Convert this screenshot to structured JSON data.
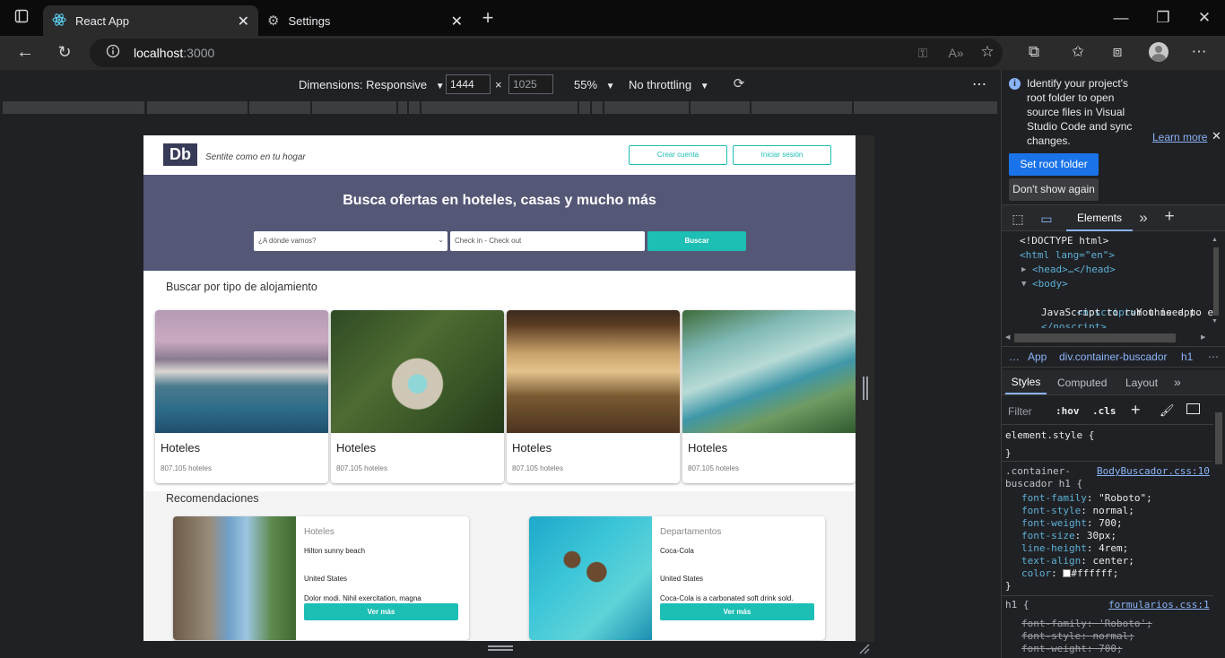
{
  "browser": {
    "tabs": [
      {
        "label": "React App",
        "active": true
      },
      {
        "label": "Settings",
        "active": false
      }
    ],
    "url_host": "localhost",
    "url_port": ":3000"
  },
  "device_toolbar": {
    "dimensions_label": "Dimensions: Responsive",
    "width": "1444",
    "times": "×",
    "height": "1025",
    "zoom": "55%",
    "throttling": "No throttling",
    "more": "⋯"
  },
  "site": {
    "logo": "Db",
    "tagline": "Sentite como en tu hogar",
    "create_account": "Crear cuenta",
    "login": "Iniciar sesión",
    "hero_title": "Busca ofertas en hoteles, casas y mucho más",
    "destination_placeholder": "¿A dónde vamos?",
    "dates_placeholder": "Check in - Check out",
    "search_button": "Buscar",
    "categories_title": "Buscar por tipo de alojamiento",
    "categories": [
      {
        "title": "Hoteles",
        "count": "807.105 hoteles"
      },
      {
        "title": "Hoteles",
        "count": "807.105 hoteles"
      },
      {
        "title": "Hoteles",
        "count": "807.105 hoteles"
      },
      {
        "title": "Hoteles",
        "count": "807.105 hoteles"
      }
    ],
    "recommendations_title": "Recomendaciones",
    "recommendations": [
      {
        "category": "Hoteles",
        "name": "Hilton sunny beach",
        "location": "United States",
        "description": "Dolor modi. Nihil exercitation, magna",
        "button": "Ver más"
      },
      {
        "category": "Departamentos",
        "name": "Coca-Cola",
        "location": "United States",
        "description": "Coca-Cola is a carbonated soft drink sold.",
        "button": "Ver más"
      }
    ]
  },
  "devtools": {
    "info_message_lines": [
      "Identify your project's",
      "root folder to open",
      "source files in Visual",
      "Studio Code and sync",
      "changes."
    ],
    "learn_more": "Learn more",
    "set_root_folder": "Set root folder",
    "dont_show_again": "Don't show again",
    "tab_elements": "Elements",
    "breadcrumb": [
      "…",
      "App",
      "div.container-buscador",
      "h1"
    ],
    "styles_tabs": [
      "Styles",
      "Computed",
      "Layout"
    ],
    "filter_placeholder": "Filter",
    "hov": ":hov",
    "cls": ".cls",
    "dom": {
      "doctype": "<!DOCTYPE html>",
      "html_open": "<html lang=\"en\">",
      "head": "<head>…</head>",
      "body": "<body>",
      "noscript_open": "<noscript>",
      "noscript_text_1": "You need to enable",
      "noscript_text_2": "JavaScript to run this app.",
      "noscript_close": "</noscript>"
    },
    "styles": {
      "element_style": "element.style {",
      "close_brace": "}",
      "rule1_selector_1": ".container-",
      "rule1_selector_2": "buscador h1 {",
      "rule1_source": "BodyBuscador.css:10",
      "rule1_props": [
        {
          "name": "font-family",
          "value": "\"Roboto\";"
        },
        {
          "name": "font-style",
          "value": "normal;"
        },
        {
          "name": "font-weight",
          "value": "700;"
        },
        {
          "name": "font-size",
          "value": "30px;"
        },
        {
          "name": "line-height",
          "value": "4rem;"
        },
        {
          "name": "text-align",
          "value": "center;"
        },
        {
          "name": "color",
          "value": "#ffffff;"
        }
      ],
      "rule2_selector": "h1 {",
      "rule2_source": "formularios.css:1",
      "rule2_props": [
        {
          "name": "font-family",
          "value": "'Roboto';"
        },
        {
          "name": "font-style",
          "value": "normal;"
        },
        {
          "name": "font-weight",
          "value": "700;"
        }
      ]
    }
  },
  "colors": {
    "accent": "#1dbeb4",
    "hero": "#545776",
    "logo_bg": "#383b58"
  }
}
